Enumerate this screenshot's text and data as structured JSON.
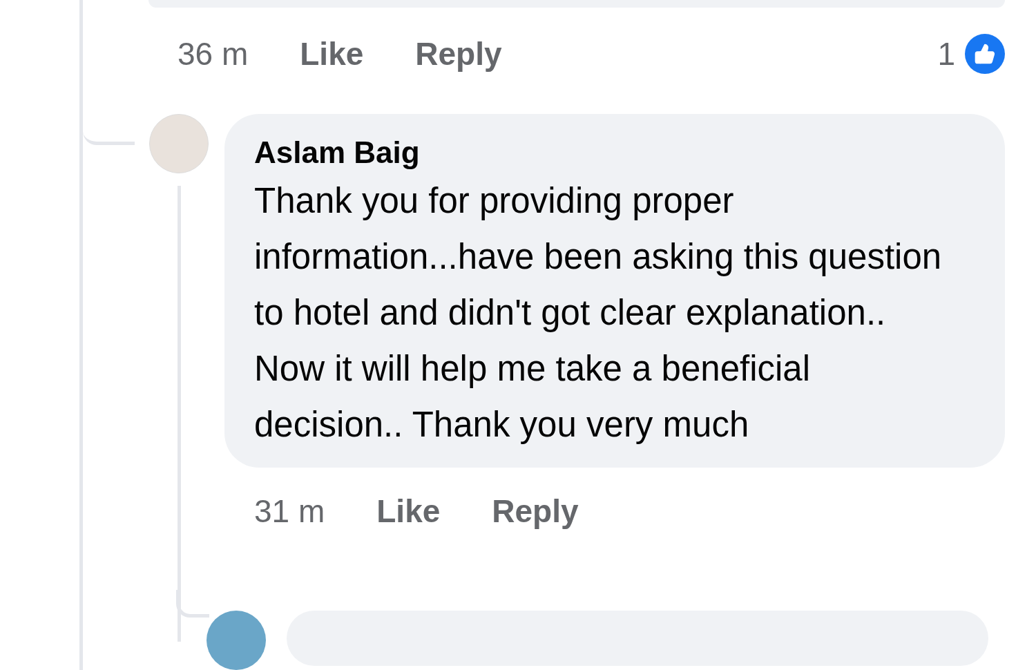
{
  "previous_comment": {
    "time": "36 m",
    "actions": [
      "Like",
      "Reply"
    ],
    "reaction_count": "1"
  },
  "reply": {
    "author": "Aslam Baig",
    "text": "Thank you for providing proper information...have been asking this question to hotel and didn't got clear explanation.. Now it will help me take a beneficial decision.. Thank you very much",
    "time": "31 m",
    "actions": [
      "Like",
      "Reply"
    ]
  }
}
